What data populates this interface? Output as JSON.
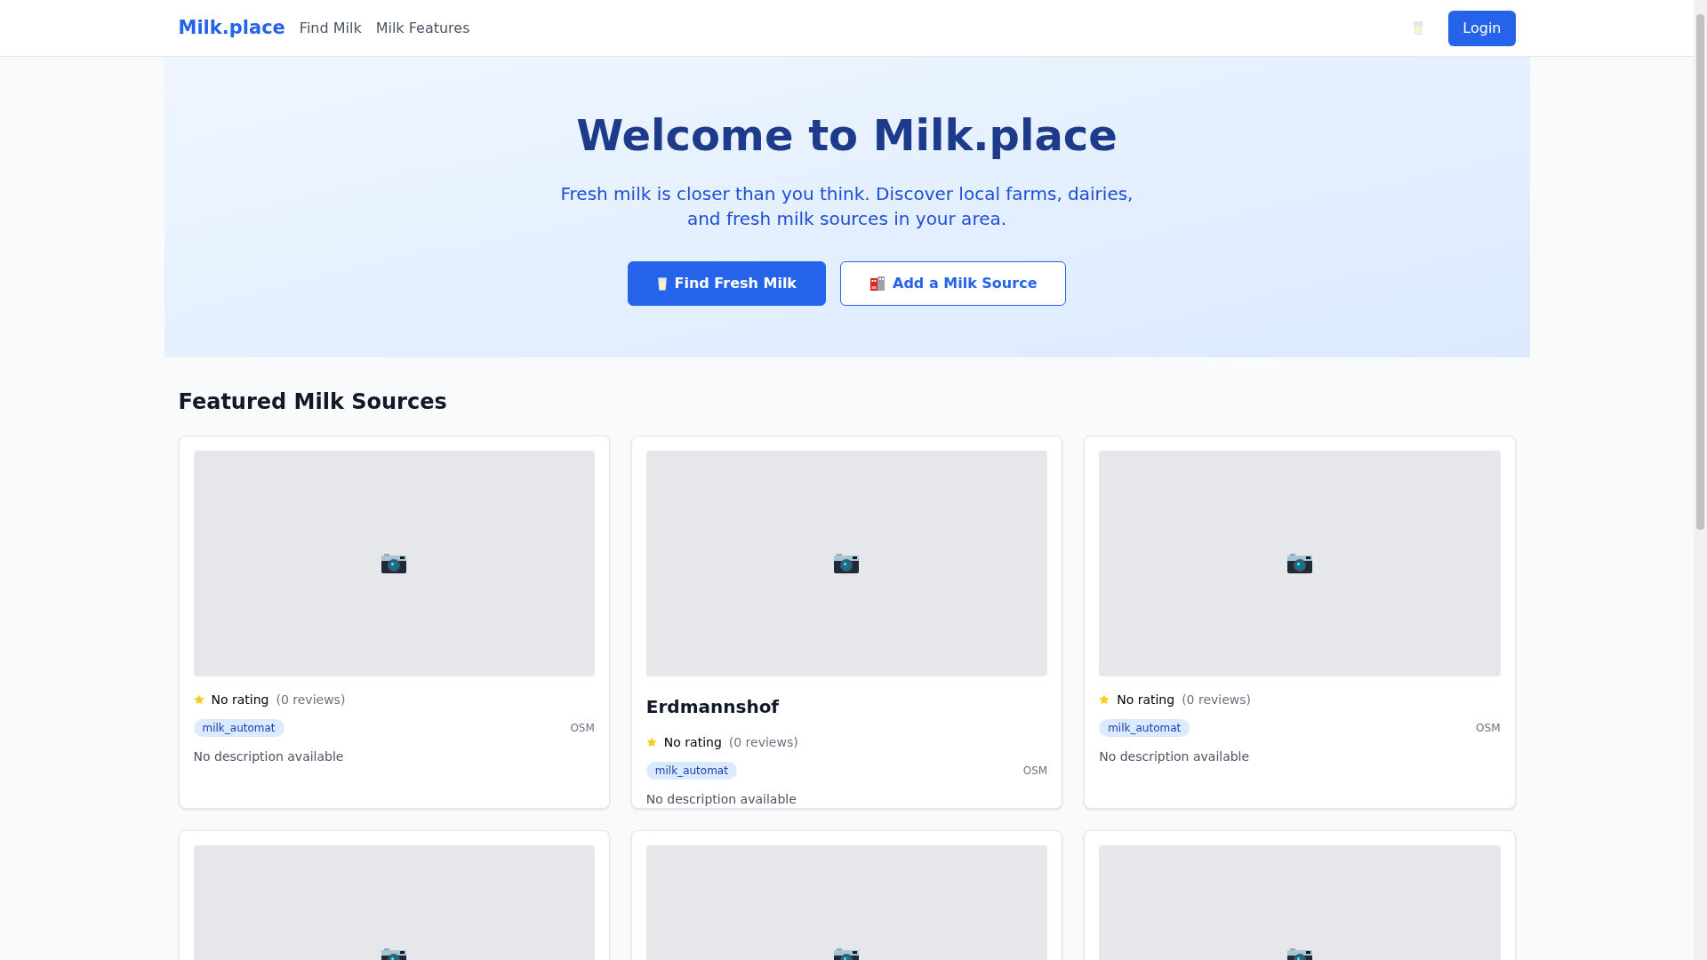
{
  "header": {
    "logo": "Milk.place",
    "nav": [
      {
        "label": "Find Milk"
      },
      {
        "label": "Milk Features"
      }
    ],
    "login": "Login"
  },
  "hero": {
    "title": "Welcome to Milk.place",
    "subtitle": "Fresh milk is closer than you think. Discover local farms, dairies, and fresh milk sources in your area.",
    "buttons": [
      {
        "kind": "primary",
        "label": "Find Fresh Milk"
      },
      {
        "kind": "outline",
        "label": "Add a Milk Source"
      }
    ]
  },
  "featured": {
    "title": "Featured Milk Sources",
    "cards": [
      {
        "kind": "listing",
        "rating": "No rating",
        "reviews": "(0 reviews)",
        "tag": "milk_automat",
        "source": "OSM",
        "description": "No description available"
      },
      {
        "kind": "listing",
        "name": "Erdmannshof",
        "rating": "No rating",
        "reviews": "(0 reviews)",
        "tag": "milk_automat",
        "source": "OSM",
        "description": "No description available"
      },
      {
        "kind": "listing",
        "rating": "No rating",
        "reviews": "(0 reviews)",
        "tag": "milk_automat",
        "source": "OSM",
        "description": "No description available"
      },
      {
        "kind": "listing"
      },
      {
        "kind": "listing"
      },
      {
        "kind": "listing"
      }
    ]
  }
}
